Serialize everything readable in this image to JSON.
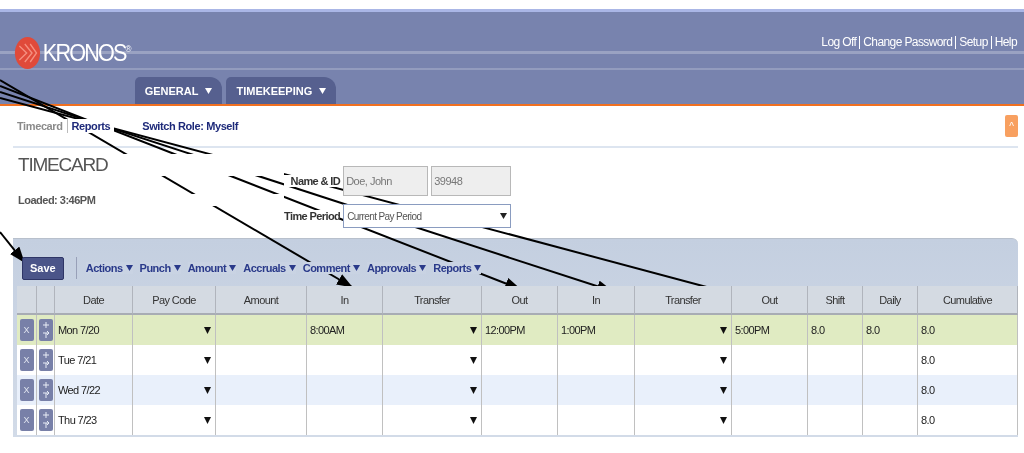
{
  "header": {
    "logo_text": "KRONOS$^{®}$",
    "tabs": [
      {
        "label": "GENERAL"
      },
      {
        "label": "TIMEKEEPING"
      }
    ],
    "links": [
      "Log Off",
      "Change Password",
      "Setup",
      "Help"
    ]
  },
  "subnav": {
    "links": [
      {
        "label": "Timecard",
        "selected": true
      },
      {
        "label": "Reports",
        "selected": false
      }
    ],
    "switch_role": "**Switch Role:** Myself",
    "collapse": "^"
  },
  "timecard": {
    "title": "TIMECARD",
    "loaded": "Loaded: 3:46PM",
    "name_label": "Name & ID",
    "name": {
      "value": "Doe, John",
      "disabled": true
    },
    "id": {
      "value": "39948",
      "disabled": true
    },
    "period_label": "Time Period",
    "period": "Current Pay Period"
  },
  "toolbar": {
    "save": "Save",
    "menus": [
      "Actions",
      "Punch",
      "Amount",
      "Accruals",
      "Comment",
      "Approvals",
      "Reports"
    ]
  },
  "table": {
    "columns": [
      "Date",
      "Pay Code",
      "Amount",
      "In",
      "Transfer",
      "Out",
      "In",
      "Transfer",
      "Out",
      "Shift",
      "Daily",
      "Cumulative"
    ],
    "rows": [
      {
        "selected": true,
        "delete_label": "X",
        "cells": [
          {
            "kind": "text",
            "text": "Mon 7/20"
          },
          {
            "kind": "dropdown"
          },
          {
            "kind": "text"
          },
          {
            "kind": "text",
            "text": "8:00AM"
          },
          {
            "kind": "dropdown"
          },
          {
            "kind": "text",
            "text": "12:00PM"
          },
          {
            "kind": "text",
            "text": "1:00PM"
          },
          {
            "kind": "dropdown"
          },
          {
            "kind": "text",
            "text": "5:00PM"
          },
          {
            "kind": "text",
            "text": "8.0"
          },
          {
            "kind": "text",
            "text": "8.0"
          },
          {
            "kind": "text",
            "text": "8.0"
          }
        ]
      },
      {
        "selected": false,
        "delete_label": "X",
        "cells": [
          {
            "kind": "text",
            "text": "Tue 7/21"
          },
          {
            "kind": "dropdown"
          },
          {
            "kind": "text"
          },
          {
            "kind": "text"
          },
          {
            "kind": "dropdown"
          },
          {
            "kind": "text"
          },
          {
            "kind": "text"
          },
          {
            "kind": "dropdown"
          },
          {
            "kind": "text"
          },
          {
            "kind": "text"
          },
          {
            "kind": "text"
          },
          {
            "kind": "text",
            "text": "8.0"
          }
        ]
      },
      {
        "selected": false,
        "delete_label": "X",
        "cells": [
          {
            "kind": "text",
            "text": "Wed 7/22"
          },
          {
            "kind": "dropdown"
          },
          {
            "kind": "text"
          },
          {
            "kind": "text"
          },
          {
            "kind": "dropdown"
          },
          {
            "kind": "text"
          },
          {
            "kind": "text"
          },
          {
            "kind": "dropdown"
          },
          {
            "kind": "text"
          },
          {
            "kind": "text"
          },
          {
            "kind": "text"
          },
          {
            "kind": "text",
            "text": "8.0"
          }
        ]
      },
      {
        "selected": false,
        "delete_label": "X",
        "cells": [
          {
            "kind": "text",
            "text": "Thu 7/23"
          },
          {
            "kind": "dropdown"
          },
          {
            "kind": "text"
          },
          {
            "kind": "text"
          },
          {
            "kind": "dropdown"
          },
          {
            "kind": "text"
          },
          {
            "kind": "text"
          },
          {
            "kind": "dropdown"
          },
          {
            "kind": "text"
          },
          {
            "kind": "text"
          },
          {
            "kind": "text"
          },
          {
            "kind": "text",
            "text": "8.0"
          }
        ]
      }
    ]
  }
}
